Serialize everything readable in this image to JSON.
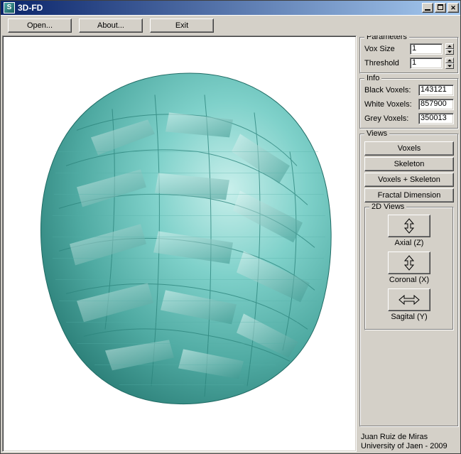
{
  "window": {
    "title": "3D-FD",
    "icon_glyph": "S"
  },
  "toolbar": {
    "open": "Open...",
    "about": "About...",
    "exit": "Exit"
  },
  "parameters": {
    "legend": "Parameters",
    "vox_size_label": "Vox Size",
    "vox_size_value": "1",
    "threshold_label": "Threshold",
    "threshold_value": "1"
  },
  "info": {
    "legend": "Info",
    "black_label": "Black Voxels:",
    "black_value": "143121",
    "white_label": "White Voxels:",
    "white_value": "857900",
    "grey_label": "Grey Voxels:",
    "grey_value": "350013"
  },
  "views": {
    "legend": "Views",
    "voxels": "Voxels",
    "skeleton": "Skeleton",
    "voxskel": "Voxels + Skeleton",
    "fd": "Fractal Dimension",
    "sub_legend": "2D Views",
    "axial": "Axial (Z)",
    "coronal": "Coronal (X)",
    "sagital": "Sagital (Y)"
  },
  "footer": {
    "line1": "Juan Ruiz de Miras",
    "line2": "University of Jaen - 2009"
  },
  "render": {
    "fill_main": "#6fc7c0",
    "fill_dark": "#2f8f87",
    "fill_light": "#b8e6e1"
  }
}
